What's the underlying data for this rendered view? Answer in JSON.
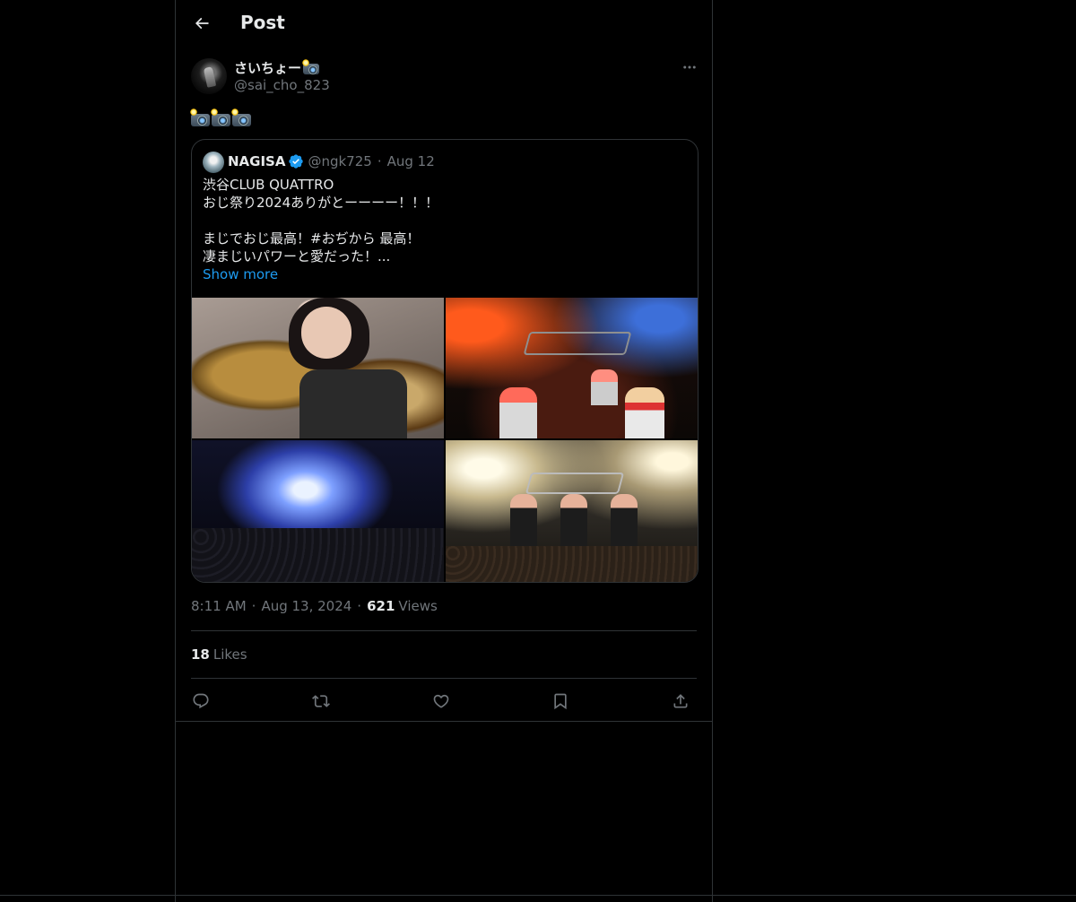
{
  "header": {
    "title": "Post",
    "back_icon": "arrow-left-icon"
  },
  "post": {
    "author": {
      "display_name": "さいちょー",
      "name_emoji": "camera-with-flash-emoji",
      "handle": "@sai_cho_823"
    },
    "text_emojis": [
      "camera-with-flash-emoji",
      "camera-with-flash-emoji",
      "camera-with-flash-emoji"
    ],
    "quoted": {
      "name": "NAGISA",
      "verified": true,
      "handle": "@ngk725",
      "separator": "·",
      "date": "Aug 12",
      "lines": [
        "渋谷CLUB QUATTRO",
        "おじ祭り2024ありがとーーーー！！！",
        "",
        "まじでおじ最高！#おぢから 最高！",
        "凄まじいパワーと愛だった！..."
      ],
      "show_more": "Show more",
      "images": [
        "drummer-closeup-photo",
        "band-on-stage-red-lights-photo",
        "concert-crowd-blue-lights-photo",
        "band-bowing-to-crowd-photo"
      ]
    },
    "meta": {
      "time": "8:11 AM",
      "separator": "·",
      "date": "Aug 13, 2024",
      "views_count": "621",
      "views_label": "Views"
    },
    "likes": {
      "count": "18",
      "label": "Likes"
    },
    "actions": [
      "reply-icon",
      "repost-icon",
      "like-icon",
      "bookmark-icon",
      "share-icon"
    ]
  },
  "colors": {
    "background": "#000000",
    "text": "#e7e9ea",
    "muted": "#71767b",
    "border": "#2f3336",
    "accent": "#1d9bf0"
  }
}
